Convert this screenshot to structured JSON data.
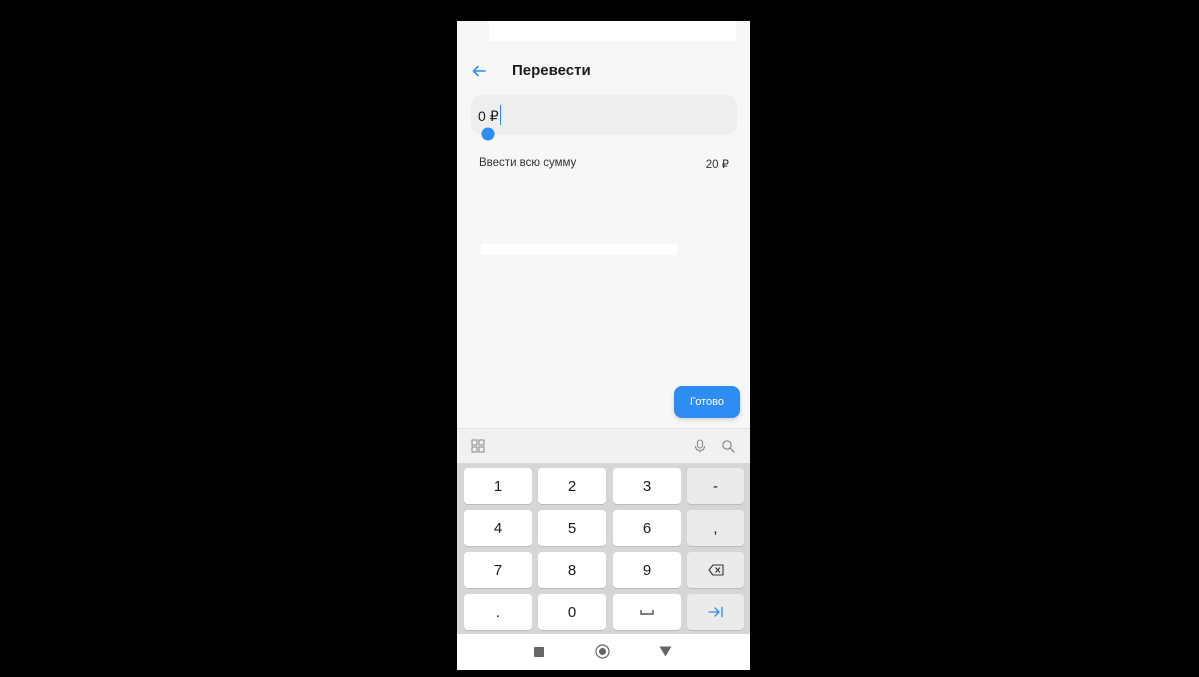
{
  "header": {
    "title": "Перевести",
    "back_icon": "arrow-left-icon"
  },
  "amount": {
    "value": "0",
    "currency": "₽"
  },
  "full_sum": {
    "label": "Ввести всю сумму",
    "balance": "20 ₽"
  },
  "done_button": {
    "label": "Готово"
  },
  "keyboard_toolbar": {
    "icons": [
      "grid-icon",
      "microphone-icon",
      "search-icon"
    ]
  },
  "keyboard": {
    "row1": [
      "1",
      "2",
      "3",
      "-"
    ],
    "row2": [
      "4",
      "5",
      "6",
      ","
    ],
    "row3": [
      "7",
      "8",
      "9"
    ],
    "row4": [
      ".",
      "0"
    ]
  },
  "colors": {
    "accent": "#2e8cf5",
    "background": "#f7f7f7",
    "keyboard_bg": "#d6d6d6"
  }
}
